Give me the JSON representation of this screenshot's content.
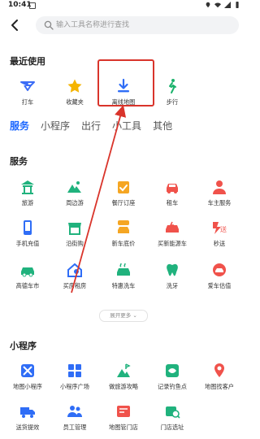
{
  "status_bar": {
    "time": "10:41"
  },
  "search": {
    "placeholder": "输入工具名称进行查找"
  },
  "recent": {
    "title": "最近使用",
    "items": [
      {
        "label": "打车",
        "icon": "taxi-icon",
        "color": "#3b6cf6"
      },
      {
        "label": "收藏夹",
        "icon": "star-icon",
        "color": "#f5b400"
      },
      {
        "label": "离线地图",
        "icon": "download-icon",
        "color": "#2f6df6"
      },
      {
        "label": "步行",
        "icon": "walk-icon",
        "color": "#1bb26b"
      }
    ]
  },
  "tabs": [
    {
      "label": "服务",
      "active": true
    },
    {
      "label": "小程序",
      "active": false
    },
    {
      "label": "出行",
      "active": false
    },
    {
      "label": "小工具",
      "active": false
    },
    {
      "label": "其他",
      "active": false
    }
  ],
  "services": {
    "title": "服务",
    "items": [
      {
        "label": "旅游",
        "icon": "temple-icon",
        "color": "#20b27d"
      },
      {
        "label": "周边游",
        "icon": "mountain-icon",
        "color": "#20b27d"
      },
      {
        "label": "餐厅订座",
        "icon": "calendar-check-icon",
        "color": "#f5a623"
      },
      {
        "label": "租车",
        "icon": "car-icon",
        "color": "#f0524b"
      },
      {
        "label": "车主服务",
        "icon": "driver-icon",
        "color": "#f0524b"
      },
      {
        "label": "手机充值",
        "icon": "phone-icon",
        "color": "#2f6df6"
      },
      {
        "label": "沿街购",
        "icon": "shop-icon",
        "color": "#20b27d"
      },
      {
        "label": "新车底价",
        "icon": "new-car-icon",
        "color": "#f5a623"
      },
      {
        "label": "买新能源车",
        "icon": "ev-car-icon",
        "color": "#f0524b"
      },
      {
        "label": "秒送",
        "icon": "express-icon",
        "color": "#f0524b"
      },
      {
        "label": "高德车市",
        "icon": "car-market-icon",
        "color": "#20b27d"
      },
      {
        "label": "买房租房",
        "icon": "house-icon",
        "color": "#2f6df6"
      },
      {
        "label": "特惠洗车",
        "icon": "car-wash-icon",
        "color": "#20b27d"
      },
      {
        "label": "洗牙",
        "icon": "tooth-icon",
        "color": "#20b27d"
      },
      {
        "label": "爱车估值",
        "icon": "car-value-icon",
        "color": "#f0524b"
      }
    ],
    "expand_label": "展开更多"
  },
  "mini_programs": {
    "title": "小程序",
    "items": [
      {
        "label": "地图小程序",
        "icon": "map-program-icon",
        "color": "#2f6df6"
      },
      {
        "label": "小程序广场",
        "icon": "grid-icon",
        "color": "#2f6df6"
      },
      {
        "label": "做旅游攻略",
        "icon": "travel-guide-icon",
        "color": "#20b27d"
      },
      {
        "label": "记录钓鱼点",
        "icon": "fishing-icon",
        "color": "#20b27d"
      },
      {
        "label": "地图找客户",
        "icon": "find-customer-icon",
        "color": "#f0524b"
      },
      {
        "label": "送货提效",
        "icon": "delivery-truck-icon",
        "color": "#2f6df6"
      },
      {
        "label": "员工管理",
        "icon": "staff-icon",
        "color": "#2f6df6"
      },
      {
        "label": "地图管门店",
        "icon": "store-map-icon",
        "color": "#f0524b"
      },
      {
        "label": "门店选址",
        "icon": "store-location-icon",
        "color": "#20b27d"
      }
    ]
  }
}
